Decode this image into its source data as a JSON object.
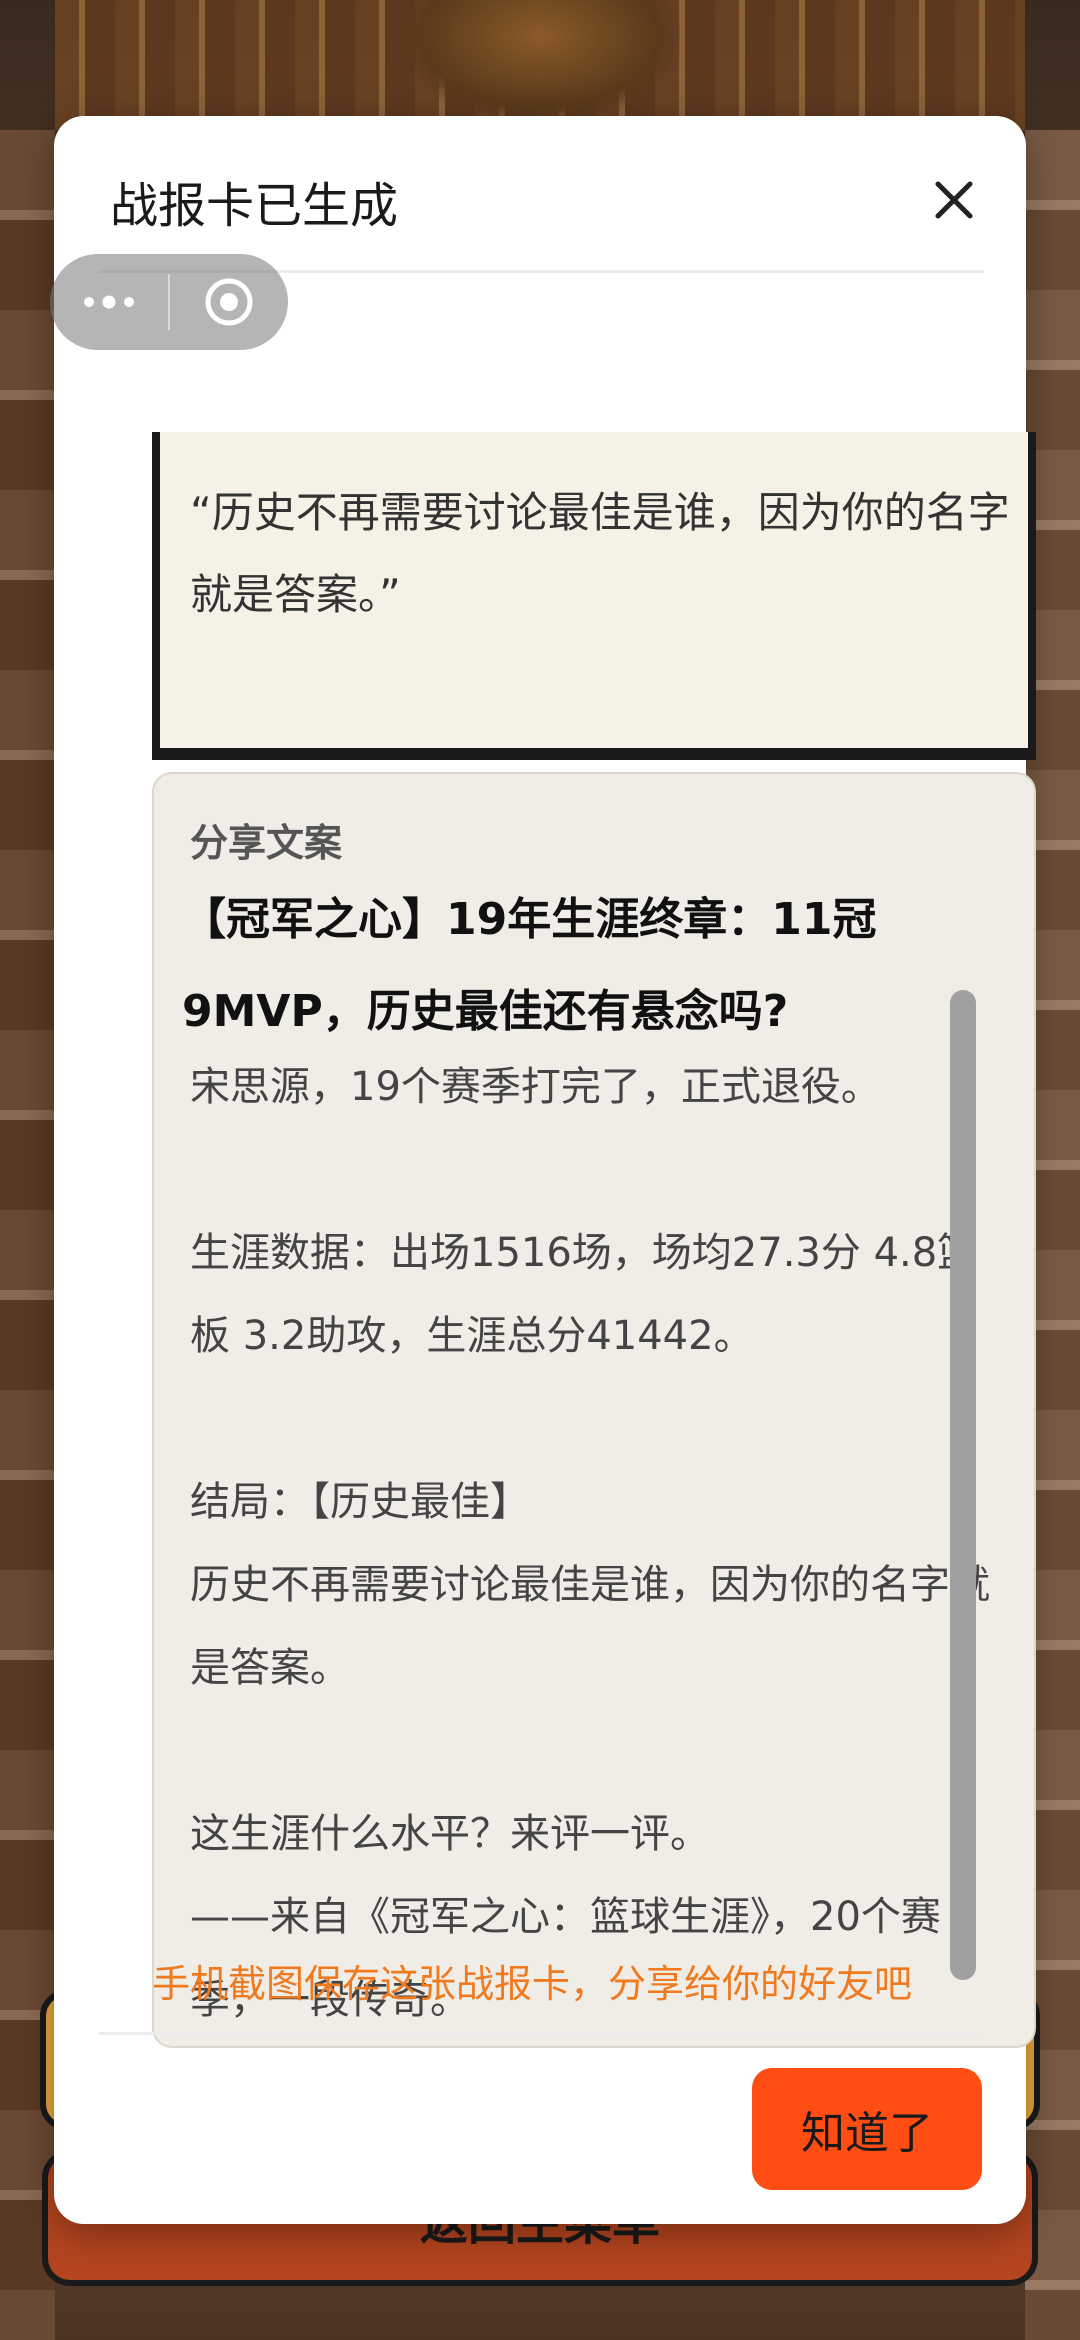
{
  "modal": {
    "title": "战报卡已生成",
    "quote": "“历史不再需要讨论最佳是谁，因为你的名字就是答案。”",
    "share": {
      "label": "分享文案",
      "headline": "【冠军之心】19年生涯终章：11冠9MVP，历史最佳还有悬念吗?",
      "body": "宋思源，19个赛季打完了，正式退役。\n\n生涯数据：出场1516场，场均27.3分 4.8篮板 3.2助攻，生涯总分41442。\n\n结局：【历史最佳】\n历史不再需要讨论最佳是谁，因为你的名字就是答案。\n\n这生涯什么水平？来评一评。\n——来自《冠军之心：篮球生涯》，20个赛季，一段传奇。"
    },
    "hint": "手机截图保存这张战报卡，分享给你的好友吧",
    "confirm_label": "知道了"
  },
  "background": {
    "back_button_label": "返回主菜单"
  },
  "colors": {
    "accent": "#ff4d14",
    "hint": "#f07a20"
  },
  "icons": {
    "close": "close-icon",
    "more": "more-dots-icon",
    "target": "target-icon"
  }
}
